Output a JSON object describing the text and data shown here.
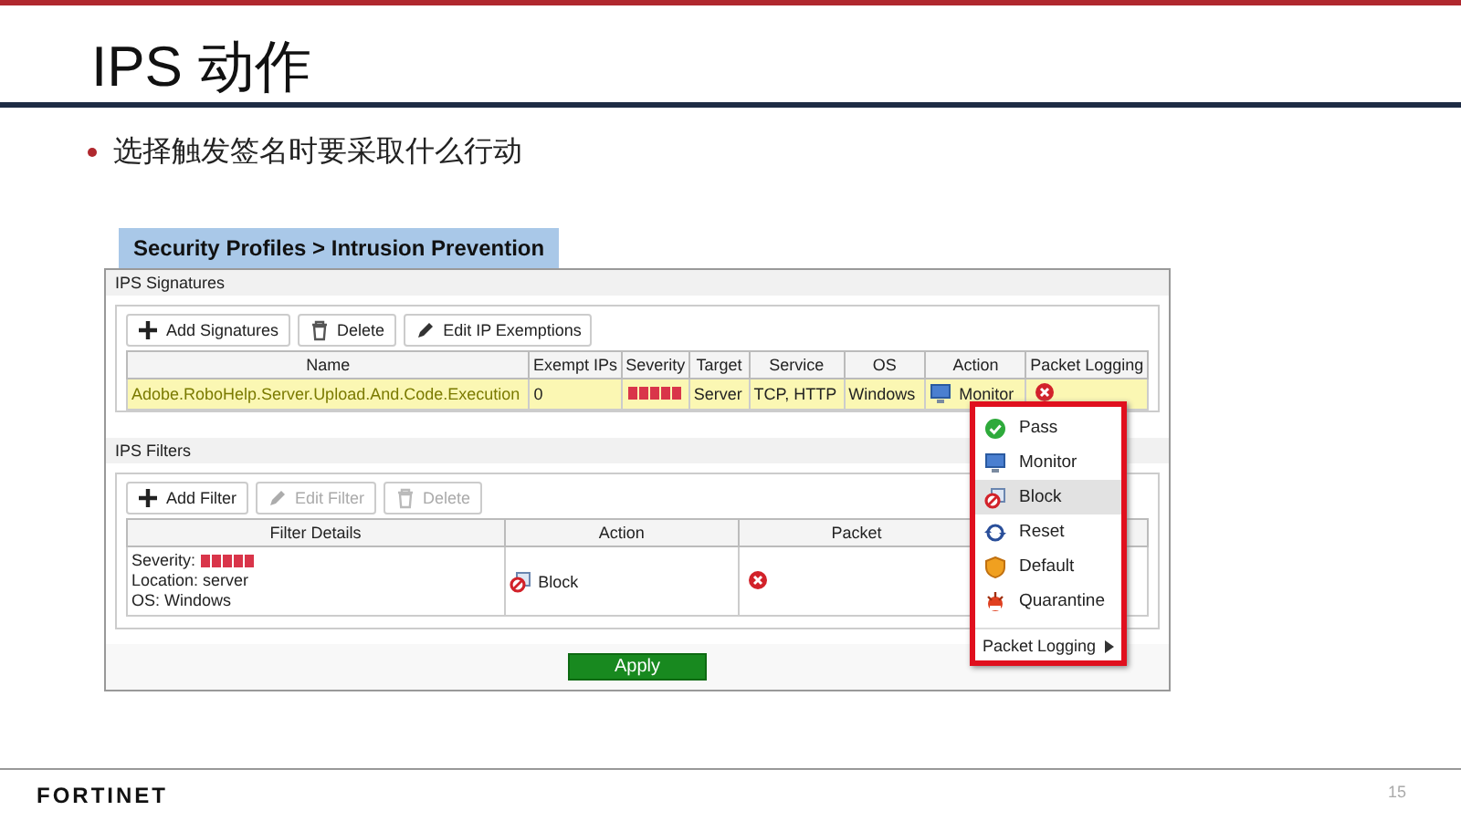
{
  "slide": {
    "title": "IPS 动作",
    "bullet": "选择触发签名时要采取什么行动"
  },
  "breadcrumb": "Security Profiles > Intrusion Prevention",
  "signatures": {
    "heading": "IPS Signatures",
    "toolbar": [
      {
        "label": "Add Signatures",
        "kind": "plus",
        "disabled": false
      },
      {
        "label": "Delete",
        "kind": "trash",
        "disabled": false
      },
      {
        "label": "Edit IP Exemptions",
        "kind": "pencil",
        "disabled": false
      }
    ],
    "columns": [
      "Name",
      "Exempt IPs",
      "Severity",
      "Target",
      "Service",
      "OS",
      "Action",
      "Packet Logging"
    ],
    "rows": [
      {
        "name": "Adobe.RoboHelp.Server.Upload.And.Code.Execution",
        "exempt_ips": "0",
        "target": "Server",
        "service": "TCP, HTTP",
        "os": "Windows",
        "action": {
          "label": "Monitor",
          "kind": "monitor"
        },
        "packet_logging": false,
        "selected": true
      }
    ]
  },
  "filters": {
    "heading": "IPS Filters",
    "toolbar": [
      {
        "label": "Add Filter",
        "kind": "plus",
        "disabled": false
      },
      {
        "label": "Edit Filter",
        "kind": "pencil",
        "disabled": true
      },
      {
        "label": "Delete",
        "kind": "trash",
        "disabled": true
      }
    ],
    "columns": [
      "Filter Details",
      "Action",
      "Packet"
    ],
    "rows": [
      {
        "severity_label": "Severity:",
        "location": "Location: server",
        "os": "OS: Windows",
        "action": {
          "label": "Block",
          "kind": "block"
        },
        "packet_logging": false
      }
    ]
  },
  "action_menu": {
    "items": [
      {
        "label": "Pass",
        "kind": "pass",
        "selected": false
      },
      {
        "label": "Monitor",
        "kind": "monitor",
        "selected": false
      },
      {
        "label": "Block",
        "kind": "block",
        "selected": true
      },
      {
        "label": "Reset",
        "kind": "reset",
        "selected": false
      },
      {
        "label": "Default",
        "kind": "default",
        "selected": false
      },
      {
        "label": "Quarantine",
        "kind": "quarantine",
        "selected": false
      }
    ],
    "submenu": "Packet Logging"
  },
  "apply": "Apply",
  "footer": {
    "logo": "FORTINET",
    "page": "15"
  }
}
